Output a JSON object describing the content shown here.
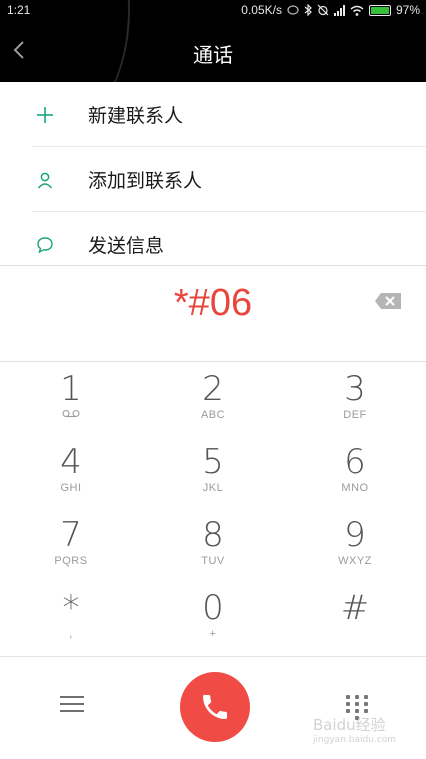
{
  "status_bar": {
    "time": "1:21",
    "speed": "0.05K/s",
    "battery": "97%",
    "battery_color": "#36c03a"
  },
  "header": {
    "title": "通话",
    "back_icon": "chevron-left-icon"
  },
  "options": [
    {
      "icon": "plus-icon",
      "label": "新建联系人"
    },
    {
      "icon": "person-icon",
      "label": "添加到联系人"
    },
    {
      "icon": "chat-bubble-icon",
      "label": "发送信息"
    }
  ],
  "accent_color": "#1ca37f",
  "dial": {
    "number": "*#06",
    "number_color": "#e8453c",
    "backspace_icon": "backspace-icon"
  },
  "keys": [
    {
      "digit": "1",
      "letters": ""
    },
    {
      "digit": "2",
      "letters": "ABC"
    },
    {
      "digit": "3",
      "letters": "DEF"
    },
    {
      "digit": "4",
      "letters": "GHI"
    },
    {
      "digit": "5",
      "letters": "JKL"
    },
    {
      "digit": "6",
      "letters": "MNO"
    },
    {
      "digit": "7",
      "letters": "PQRS"
    },
    {
      "digit": "8",
      "letters": "TUV"
    },
    {
      "digit": "9",
      "letters": "WXYZ"
    },
    {
      "digit": "*",
      "letters": ","
    },
    {
      "digit": "0",
      "letters": "+"
    },
    {
      "digit": "#",
      "letters": ""
    }
  ],
  "bottom_bar": {
    "menu_icon": "menu-icon",
    "call_icon": "phone-icon",
    "call_color": "#f04c45",
    "keypad_icon": "dialpad-icon"
  },
  "watermark": {
    "text": "Baidu经验",
    "url": "jingyan.baidu.com"
  }
}
